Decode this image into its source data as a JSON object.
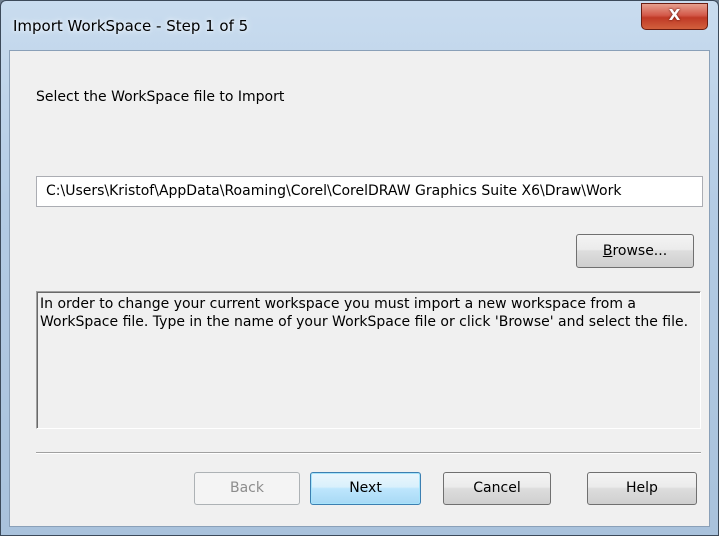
{
  "window": {
    "title": "Import WorkSpace - Step 1 of 5",
    "close_label": "X"
  },
  "dialog": {
    "prompt": "Select the WorkSpace file to Import",
    "file_path": "C:\\Users\\Kristof\\AppData\\Roaming\\Corel\\CorelDRAW Graphics Suite X6\\Draw\\Work",
    "browse_label_underlined": "B",
    "browse_label_rest": "rowse...",
    "description": "In order to change your current workspace you must import a new workspace from a WorkSpace file. Type in the name of your WorkSpace file or click 'Browse' and select the file."
  },
  "buttons": {
    "back": "Back",
    "next": "Next",
    "cancel": "Cancel",
    "help": "Help"
  },
  "state": {
    "back_enabled": false,
    "default_button": "next"
  },
  "colors": {
    "title_bar": "#b3cbe4",
    "close_button": "#c03a26",
    "dialog_face": "#f0f0f0",
    "default_button_border": "#3c7fb1"
  }
}
